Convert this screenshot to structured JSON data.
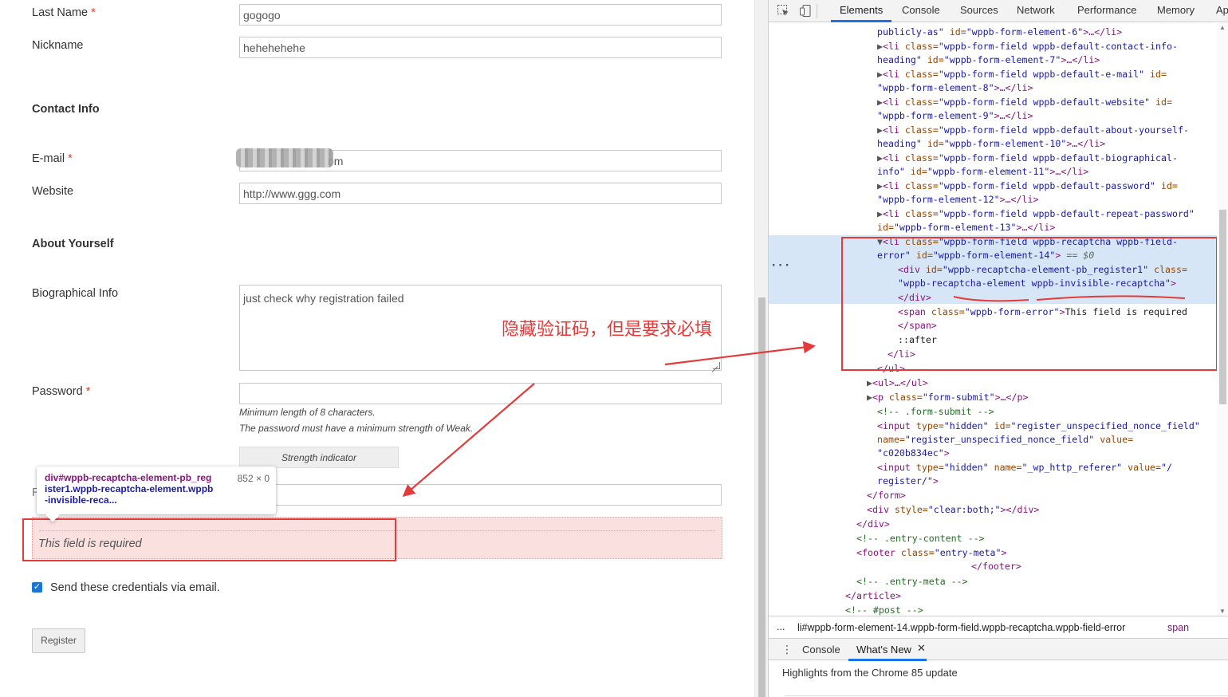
{
  "form": {
    "last_name": {
      "label": "Last Name",
      "required": "*",
      "value": "gogogo"
    },
    "nickname": {
      "label": "Nickname",
      "value": "hehehehehe"
    },
    "contact_heading": "Contact Info",
    "email": {
      "label": "E-mail",
      "required": "*",
      "value_visible": "om"
    },
    "website": {
      "label": "Website",
      "value": "http://www.ggg.com"
    },
    "about_heading": "About Yourself",
    "bio": {
      "label": "Biographical Info",
      "value": "just check why registration failed"
    },
    "password": {
      "label": "Password",
      "required": "*",
      "value": "",
      "hint1": "Minimum length of 8 characters.",
      "hint2": "The password must have a minimum strength of Weak.",
      "strength": "Strength indicator"
    },
    "repeat_password_label_fragment": "R",
    "recaptcha_error": "This field is required",
    "send_credentials": {
      "label": "Send these credentials via email.",
      "checked": true
    },
    "register_button": "Register"
  },
  "tooltip": {
    "selector_line1": "div#wppb-recaptcha-element-pb_reg",
    "selector_line2": "ister1.wppb-recaptcha-element.wppb",
    "selector_line3": "-invisible-reca...",
    "dims": "852 × 0"
  },
  "annotation": {
    "text": "隐藏验证码，但是要求必填",
    "color": "#e43a3a"
  },
  "devtools": {
    "tabs": [
      "Elements",
      "Console",
      "Sources",
      "Network",
      "Performance",
      "Memory",
      "Ap"
    ],
    "active_tab": "Elements",
    "dom": {
      "l0": {
        "a1": "publicly-as\"",
        "a2": " id=",
        "v2": "\"wppb-form-element-6\"",
        "end": ">…</li>"
      },
      "l1": {
        "pre": "<li",
        "an": " class=",
        "av": "\"wppb-form-field wppb-default-contact-info-"
      },
      "l2": {
        "av": "heading\"",
        "an": " id=",
        "v": "\"wppb-form-element-7\"",
        "end": ">…</li>"
      },
      "l3": {
        "pre": "<li",
        "an": " class=",
        "av": "\"wppb-form-field wppb-default-e-mail\"",
        "an2": " id="
      },
      "l4": {
        "v": "\"wppb-form-element-8\"",
        "end": ">…</li>"
      },
      "l5": {
        "pre": "<li",
        "an": " class=",
        "av": "\"wppb-form-field wppb-default-website\"",
        "an2": " id="
      },
      "l6": {
        "v": "\"wppb-form-element-9\"",
        "end": ">…</li>"
      },
      "l7": {
        "pre": "<li",
        "an": " class=",
        "av": "\"wppb-form-field wppb-default-about-yourself-"
      },
      "l8": {
        "av": "heading\"",
        "an": " id=",
        "v": "\"wppb-form-element-10\"",
        "end": ">…</li>"
      },
      "l9": {
        "pre": "<li",
        "an": " class=",
        "av": "\"wppb-form-field wppb-default-biographical-"
      },
      "l10": {
        "av": "info\"",
        "an": " id=",
        "v": "\"wppb-form-element-11\"",
        "end": ">…</li>"
      },
      "l11": {
        "pre": "<li",
        "an": " class=",
        "av": "\"wppb-form-field wppb-default-password\"",
        "an2": " id="
      },
      "l12": {
        "v": "\"wppb-form-element-12\"",
        "end": ">…</li>"
      },
      "l13": {
        "pre": "<li",
        "an": " class=",
        "av": "\"wppb-form-field wppb-default-repeat-password\""
      },
      "l14": {
        "an": "id=",
        "v": "\"wppb-form-element-13\"",
        "end": ">…</li>"
      },
      "l15": {
        "pre": "<li",
        "an": " class=",
        "av": "\"wppb-form-field wppb-recaptcha wppb-field-"
      },
      "l16": {
        "av": "error\"",
        "an": " id=",
        "v": "\"wppb-form-element-14\"",
        "end": ">",
        "eq": " == $0"
      },
      "l17": {
        "pre": "<div",
        "an": " id=",
        "av": "\"wppb-recaptcha-element-pb_register1\"",
        "an2": " class="
      },
      "l18": {
        "av": "\"wppb-recaptcha-element wppb-invisible-recaptcha\"",
        "end": ">"
      },
      "l19": "</div>",
      "l20": {
        "pre": "<span",
        "an": " class=",
        "av": "\"wppb-form-error\"",
        "end": ">",
        "tx": "This field is required"
      },
      "l21": "</span>",
      "l22": "::after",
      "l23": "</li>",
      "l24": "</ul>",
      "l25": {
        "pre": "<ul>",
        "end": "…</ul>"
      },
      "l26": {
        "pre": "<p",
        "an": " class=",
        "av": "\"form-submit\"",
        "end": ">…</p>"
      },
      "l27": "<!-- .form-submit -->",
      "l28": {
        "pre": "<input",
        "an": " type=",
        "av": "\"hidden\"",
        "an2": " id=",
        "av2": "\"register_unspecified_nonce_field\""
      },
      "l29": {
        "an": "name=",
        "av": "\"register_unspecified_nonce_field\"",
        "an2": " value="
      },
      "l30": {
        "av": "\"c020b834ec\"",
        "end": ">"
      },
      "l31": {
        "pre": "<input",
        "an": " type=",
        "av": "\"hidden\"",
        "an2": " name=",
        "av2": "\"_wp_http_referer\"",
        "an3": " value=",
        "av3": "\"/"
      },
      "l32": {
        "av": "register/\"",
        "end": ">"
      },
      "l33": "</form>",
      "l34": {
        "pre": "<div",
        "an": " style=",
        "av": "\"clear:both;\"",
        "end": "></div>"
      },
      "l35": "</div>",
      "l36": "<!-- .entry-content -->",
      "l37": {
        "pre": "<footer",
        "an": " class=",
        "av": "\"entry-meta\"",
        "end": ">"
      },
      "l38": "</footer>",
      "l39": "<!-- .entry-meta -->",
      "l40": "</article>",
      "l41": "<!-- #post -->"
    },
    "breadcrumb": {
      "dots": "...",
      "path": "li#wppb-form-element-14.wppb-form-field.wppb-recaptcha.wppb-field-error",
      "last": "span"
    },
    "drawer": {
      "tab1": "Console",
      "tab2": "What's New",
      "close": "✕",
      "content": "Highlights from the Chrome 85 update"
    }
  }
}
